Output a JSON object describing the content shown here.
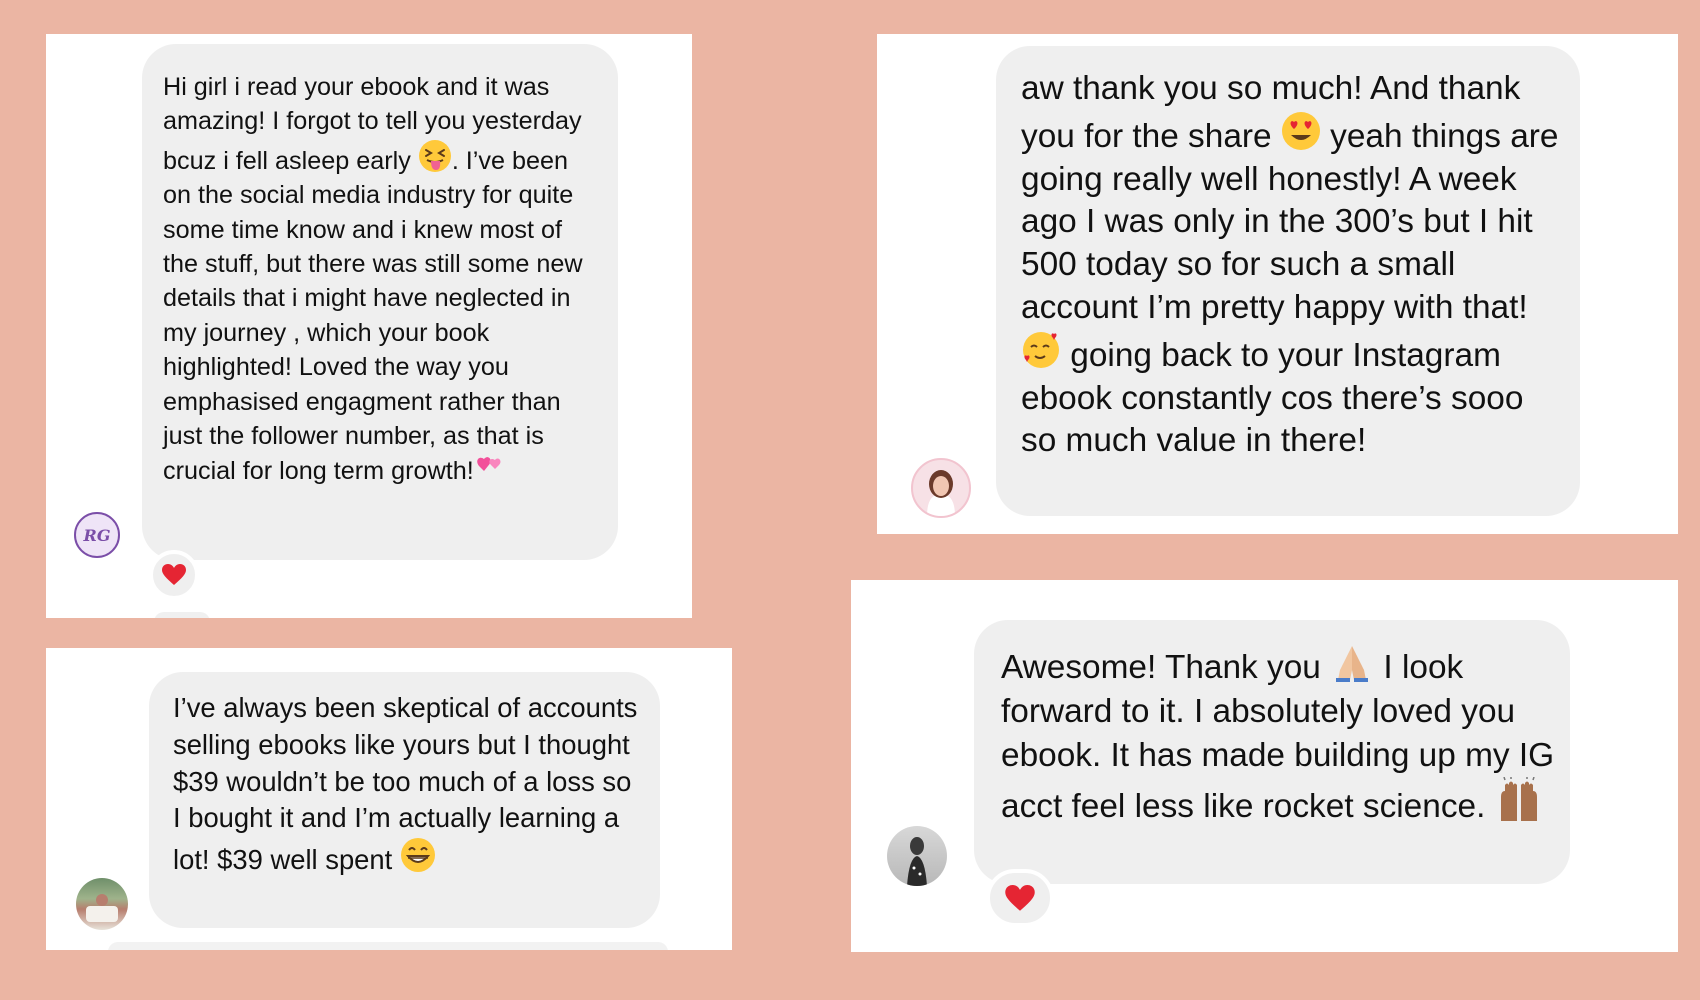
{
  "colors": {
    "background": "#EBB5A3",
    "card": "#FFFFFF",
    "bubble": "#EFEFEF",
    "heart": "#E52533"
  },
  "messages": [
    {
      "id": "rg-craft-co",
      "avatar_icon": "rg-logo-avatar",
      "avatar_text": "RG",
      "reaction_icon": "red-heart-icon",
      "segments": [
        "Hi girl i read your ebook and it was amazing! I forgot to tell you yesterday bcuz i fell asleep early ",
        ". I’ve been on the social media industry for quite some time know and i knew most of the stuff, but there was still some new details that i might have neglected in my journey , which your book highlighted! Loved the way you emphasised engagment rather than just the follower number, as that is crucial for long term growth!"
      ],
      "emojis": [
        "squinting-tongue-emoji",
        "two-hearts-emoji"
      ]
    },
    {
      "id": "skeptical-buyer",
      "avatar_icon": "profile-photo-avatar",
      "segments": [
        "I’ve always been skeptical of accounts selling ebooks like yours but I thought $39 wouldn’t be too much of a loss so I bought it and I’m actually learning a lot! $39 well spent "
      ],
      "emojis": [
        "grinning-emoji"
      ]
    },
    {
      "id": "growing-account",
      "avatar_icon": "profile-photo-avatar",
      "segments": [
        "aw thank you so much! And thank you for the share ",
        " yeah things are going really well honestly! A week ago I was only in the 300’s but I hit 500 today so for such a small account I’m pretty happy with that! ",
        " going back to your Instagram ebook constantly cos there’s sooo so much value in there!"
      ],
      "emojis": [
        "heart-eyes-emoji",
        "smiling-hearts-emoji"
      ]
    },
    {
      "id": "rocket-science",
      "avatar_icon": "profile-photo-avatar",
      "reaction_icon": "red-heart-icon",
      "segments": [
        "Awesome! Thank you ",
        " I look forward to it. I absolutely loved you ebook. It has made building up my IG acct feel less like rocket science. "
      ],
      "emojis": [
        "folded-hands-emoji",
        "raising-hands-emoji"
      ]
    }
  ]
}
